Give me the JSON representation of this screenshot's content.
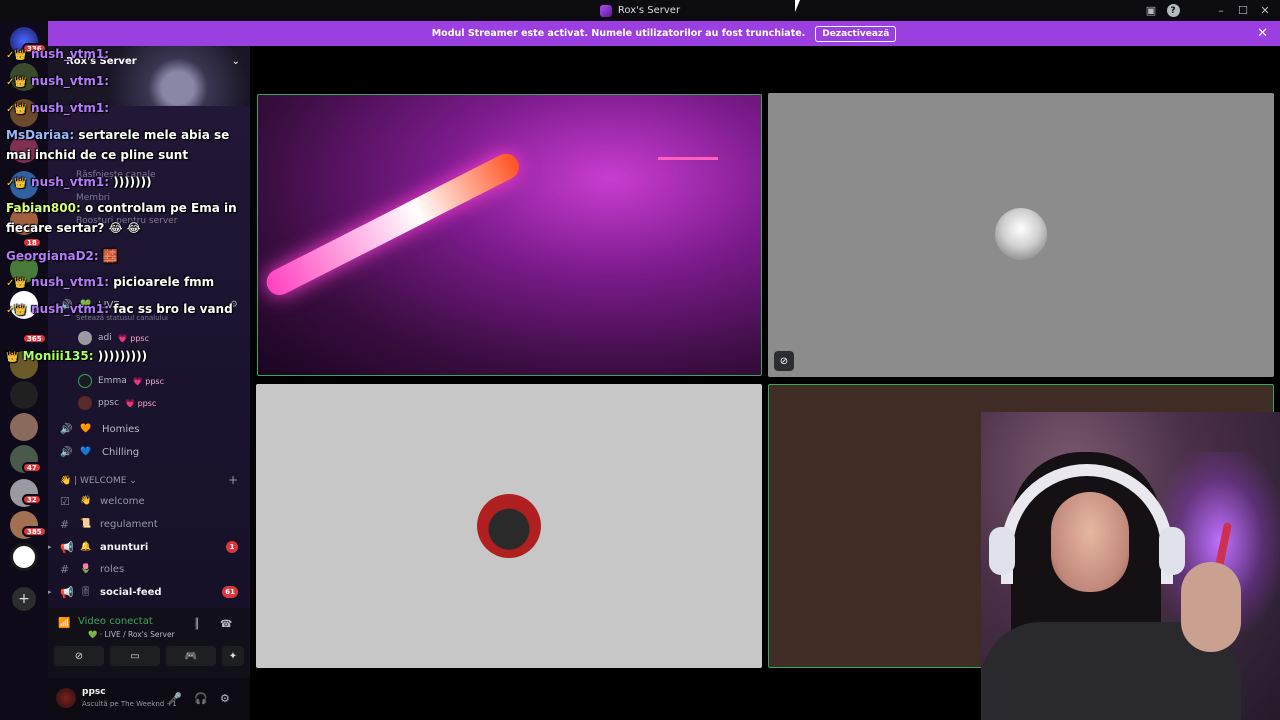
{
  "window": {
    "title": "Rox's Server"
  },
  "banner": {
    "text": "Modul Streamer este activat. Numele utilizatorilor au fost trunchiate.",
    "button_label": "Dezactivează",
    "close_glyph": "✕"
  },
  "rail": {
    "badges": [
      "336",
      "18",
      "365",
      "47",
      "32",
      "385"
    ],
    "add_glyph": "+"
  },
  "sidebar": {
    "server_name": "Rox's Server",
    "faded_items": [
      "Răsfoiește canale",
      "Membri",
      "Boosturi pentru server"
    ],
    "live_channel": "LIVE",
    "live_status": "Setează statusul canalului",
    "members": [
      {
        "name": "adi",
        "tag": "ppsc"
      },
      {
        "name": "Emma",
        "tag": "ppsc"
      },
      {
        "name": "ppsc",
        "tag": "ppsc"
      }
    ],
    "voice_channels": [
      {
        "label": "Homies",
        "emoji": "🧡"
      },
      {
        "label": "Chilling",
        "emoji": "💙"
      }
    ],
    "category": "| WELCOME",
    "text_channels": [
      {
        "label": "welcome",
        "emoji": "👋",
        "bold": false,
        "count": ""
      },
      {
        "label": "regulament",
        "emoji": "📜",
        "bold": false,
        "count": ""
      },
      {
        "label": "anunturi",
        "emoji": "🔔",
        "bold": true,
        "count": "1"
      },
      {
        "label": "roles",
        "emoji": "🌷",
        "bold": false,
        "count": ""
      },
      {
        "label": "social-feed",
        "emoji": "🎚",
        "bold": true,
        "count": "61"
      }
    ]
  },
  "voice_panel": {
    "status": "Video conectat",
    "sub": "LIVE / Rox's Server"
  },
  "user": {
    "name": "ppsc",
    "status": "Ascultă pe The Weeknd +1"
  },
  "chat": [
    {
      "name": "nush_vtm1:",
      "text": "",
      "color": "purple"
    },
    {
      "name": "nush_vtm1:",
      "text": "",
      "color": "purple"
    },
    {
      "name": "nush_vtm1:",
      "text": "",
      "color": "purple"
    },
    {
      "name": "MsDariaa:",
      "text": "sertarele mele abia se mai inchid de ce pline sunt",
      "color": "purple"
    },
    {
      "name": "nush_vtm1:",
      "text": ")))))))",
      "color": "purple"
    },
    {
      "name": "Fabian800:",
      "text": "o controlam pe Ema in fiecare sertar? 😂 😂",
      "color": "yellow"
    },
    {
      "name": "GeorgianaD2:",
      "text": "🧱",
      "color": "purple"
    },
    {
      "name": "nush_vtm1:",
      "text": "picioarele fmm",
      "color": "purple"
    },
    {
      "name": "nush_vtm1:",
      "text": "fac ss bro le vand",
      "color": "purple"
    },
    {
      "name": "Moniii135:",
      "text": ")))))))))",
      "color": "lime"
    }
  ],
  "colors": {
    "accent": "#9b3fe0",
    "speaking": "#3ba55c",
    "badge": "#da373c"
  }
}
